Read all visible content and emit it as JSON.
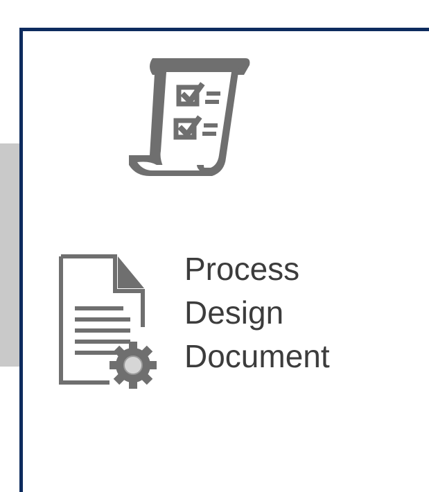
{
  "colors": {
    "panel_border": "#0d2b5e",
    "icon_gray": "#6f6f6f",
    "label_text": "#3c3c3c",
    "side_tab": "#c9c9c9"
  },
  "icons": {
    "checklist": "checklist-scroll-icon",
    "document": "document-settings-icon"
  },
  "item": {
    "label_lines": [
      "Process",
      "Design",
      "Document"
    ]
  }
}
